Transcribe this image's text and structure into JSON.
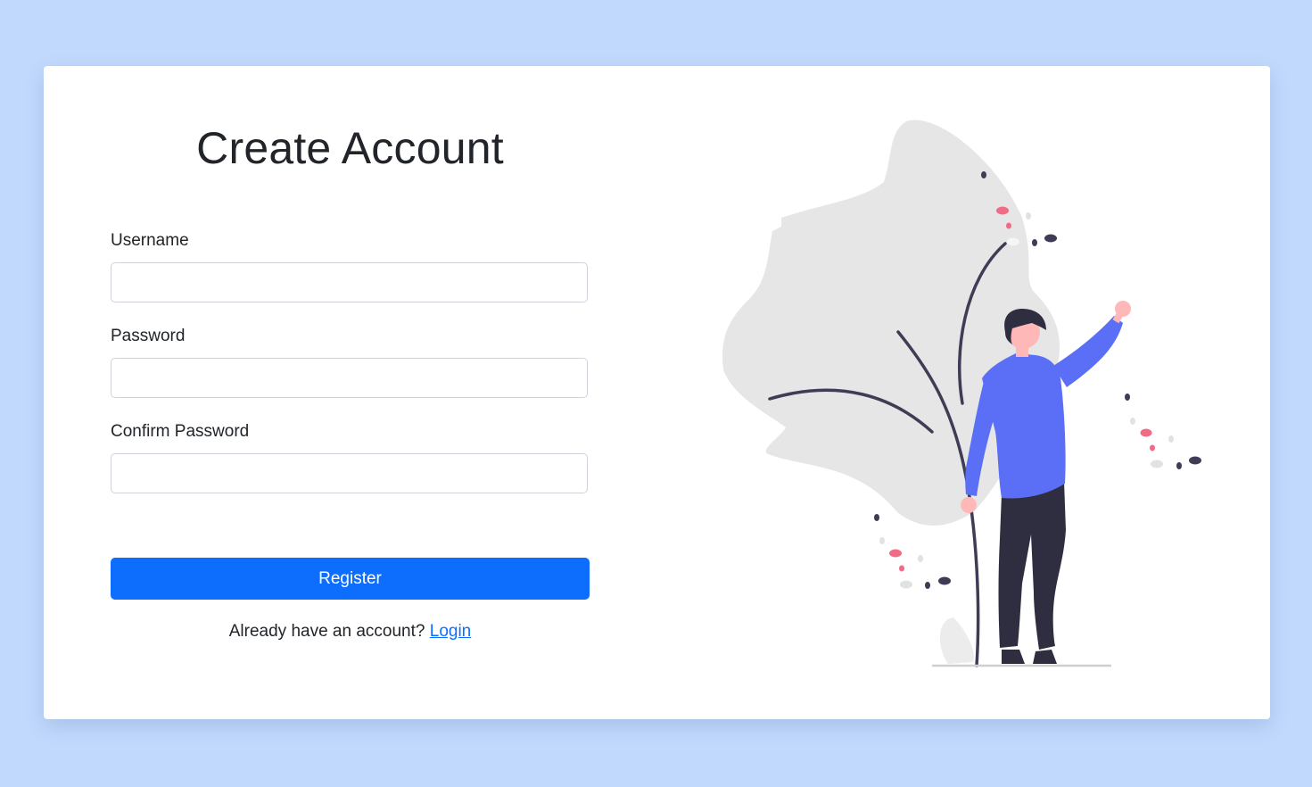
{
  "form": {
    "title": "Create Account",
    "username_label": "Username",
    "username_value": "",
    "password_label": "Password",
    "password_value": "",
    "confirm_label": "Confirm Password",
    "confirm_value": "",
    "register_label": "Register",
    "login_prompt": "Already have an account?",
    "login_link": "Login"
  },
  "colors": {
    "page_background": "#c1d9fd",
    "primary": "#0d6efd",
    "illustration_shirt": "#5a6ff5",
    "illustration_blob": "#e6e6e6",
    "illustration_accent": "#f06b85",
    "illustration_dark": "#2f2e41"
  },
  "illustration": {
    "icon": "person-waving-illustration"
  }
}
